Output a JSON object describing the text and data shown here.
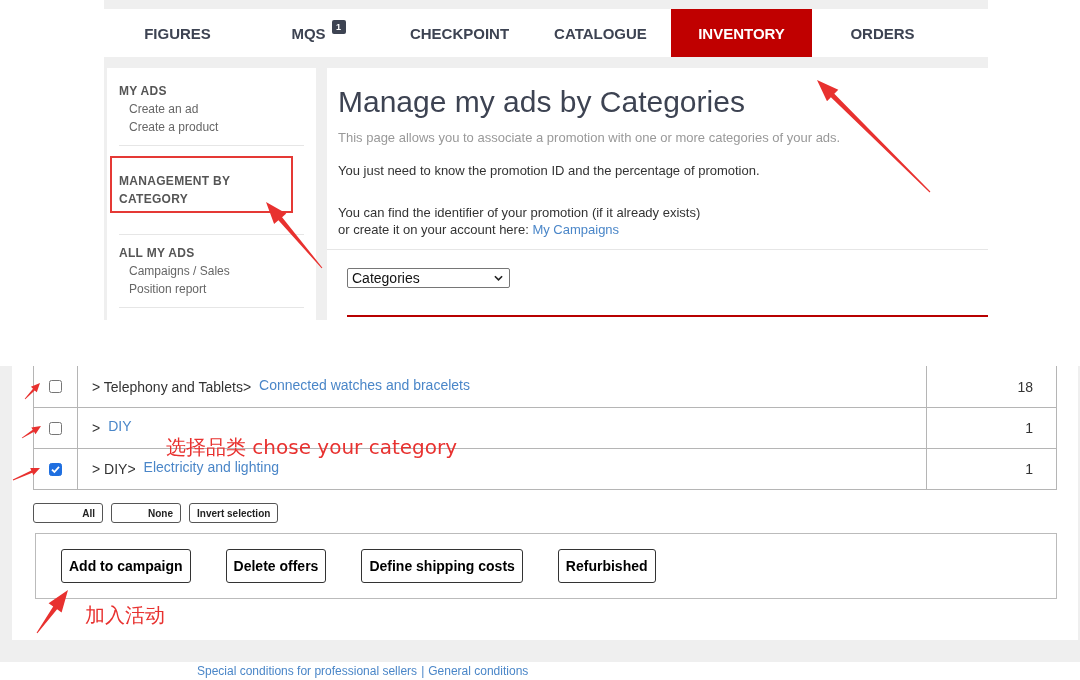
{
  "nav": {
    "tabs": [
      {
        "label": "FIGURES",
        "selected": false
      },
      {
        "label": "MQS",
        "badge": "1",
        "selected": false
      },
      {
        "label": "CHECKPOINT",
        "selected": false
      },
      {
        "label": "CATALOGUE",
        "selected": false
      },
      {
        "label": "INVENTORY",
        "selected": true
      },
      {
        "label": "ORDERS",
        "selected": false
      }
    ]
  },
  "sidebar": {
    "sections": [
      {
        "heading": "MY ADS",
        "highlighted": false,
        "items": [
          "Create an ad",
          "Create a product"
        ]
      },
      {
        "heading": "MANAGEMENT BY CATEGORY",
        "highlighted": true
      },
      {
        "heading": "ALL MY ADS",
        "highlighted": false,
        "items": [
          "Campaigns / Sales",
          "Position report"
        ]
      }
    ]
  },
  "main": {
    "title": "Manage my ads by Categories",
    "intro": "This page allows you to associate a promotion with one or more categories of your ads.",
    "info": "You just need to know the promotion ID and the percentage of promotion.",
    "help": {
      "lines": [
        "You can find the identifier of your promotion (if it already exists)",
        "or create it on your account here:"
      ],
      "link": "My Campaigns"
    },
    "select": {
      "value": "Categories"
    }
  },
  "category_table": {
    "annotation": "选择品类 chose your category",
    "rows": [
      {
        "checked": false,
        "path": "> Telephony and Tablets>",
        "category": "Connected watches and bracelets",
        "count": "18"
      },
      {
        "checked": false,
        "path": ">",
        "category": "DIY",
        "count": "1"
      },
      {
        "checked": true,
        "path": "> DIY>",
        "category": "Electricity and lighting",
        "count": "1"
      }
    ]
  },
  "selection_buttons": [
    "All",
    "None",
    "Invert selection"
  ],
  "actions": {
    "buttons": [
      "Add to campaign",
      "Delete offers",
      "Define shipping costs",
      "Refurbished"
    ],
    "annotation": "加入活动"
  },
  "footer": {
    "links": [
      "Special conditions for professional sellers",
      "General conditions"
    ],
    "separator": "|"
  }
}
